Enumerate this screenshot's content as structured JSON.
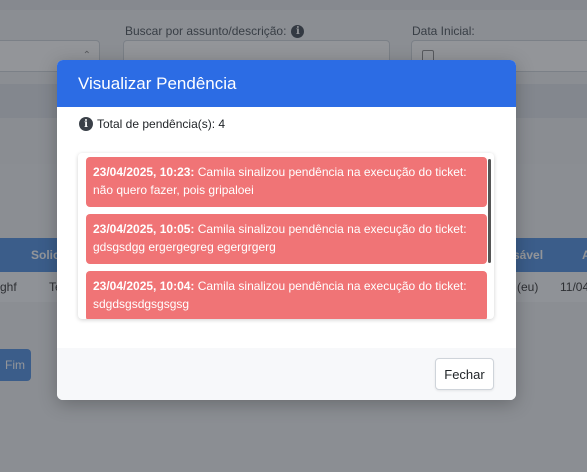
{
  "background": {
    "search_label": "Buscar por assunto/descrição:",
    "date_label": "Data Inicial:",
    "table_headers": [
      "Solic",
      "sável",
      "A"
    ],
    "table_row": [
      "ghf",
      "Te",
      "(eu)",
      "11/04"
    ],
    "fim_button": "Fim",
    "colors": {
      "header": "#4f8fe0",
      "fim_button": "#4f8fe0"
    }
  },
  "modal": {
    "title": "Visualizar Pendência",
    "total_label": "Total de pendência(s): 4",
    "info_icon_glyph": "i",
    "items": [
      {
        "timestamp": "23/04/2025, 10:23:",
        "text": " Camila sinalizou pendência na execução do ticket: não quero fazer, pois gripaloei"
      },
      {
        "timestamp": "23/04/2025, 10:05:",
        "text": " Camila sinalizou pendência na execução do ticket: gdsgsdgg ergergegreg egergrgerg"
      },
      {
        "timestamp": "23/04/2025, 10:04:",
        "text": " Camila sinalizou pendência na execução do ticket: sdgdsgsdgsgsgsg"
      }
    ],
    "close_button": "Fechar",
    "colors": {
      "header": "#2c6ce4",
      "item": "#f07476"
    }
  }
}
